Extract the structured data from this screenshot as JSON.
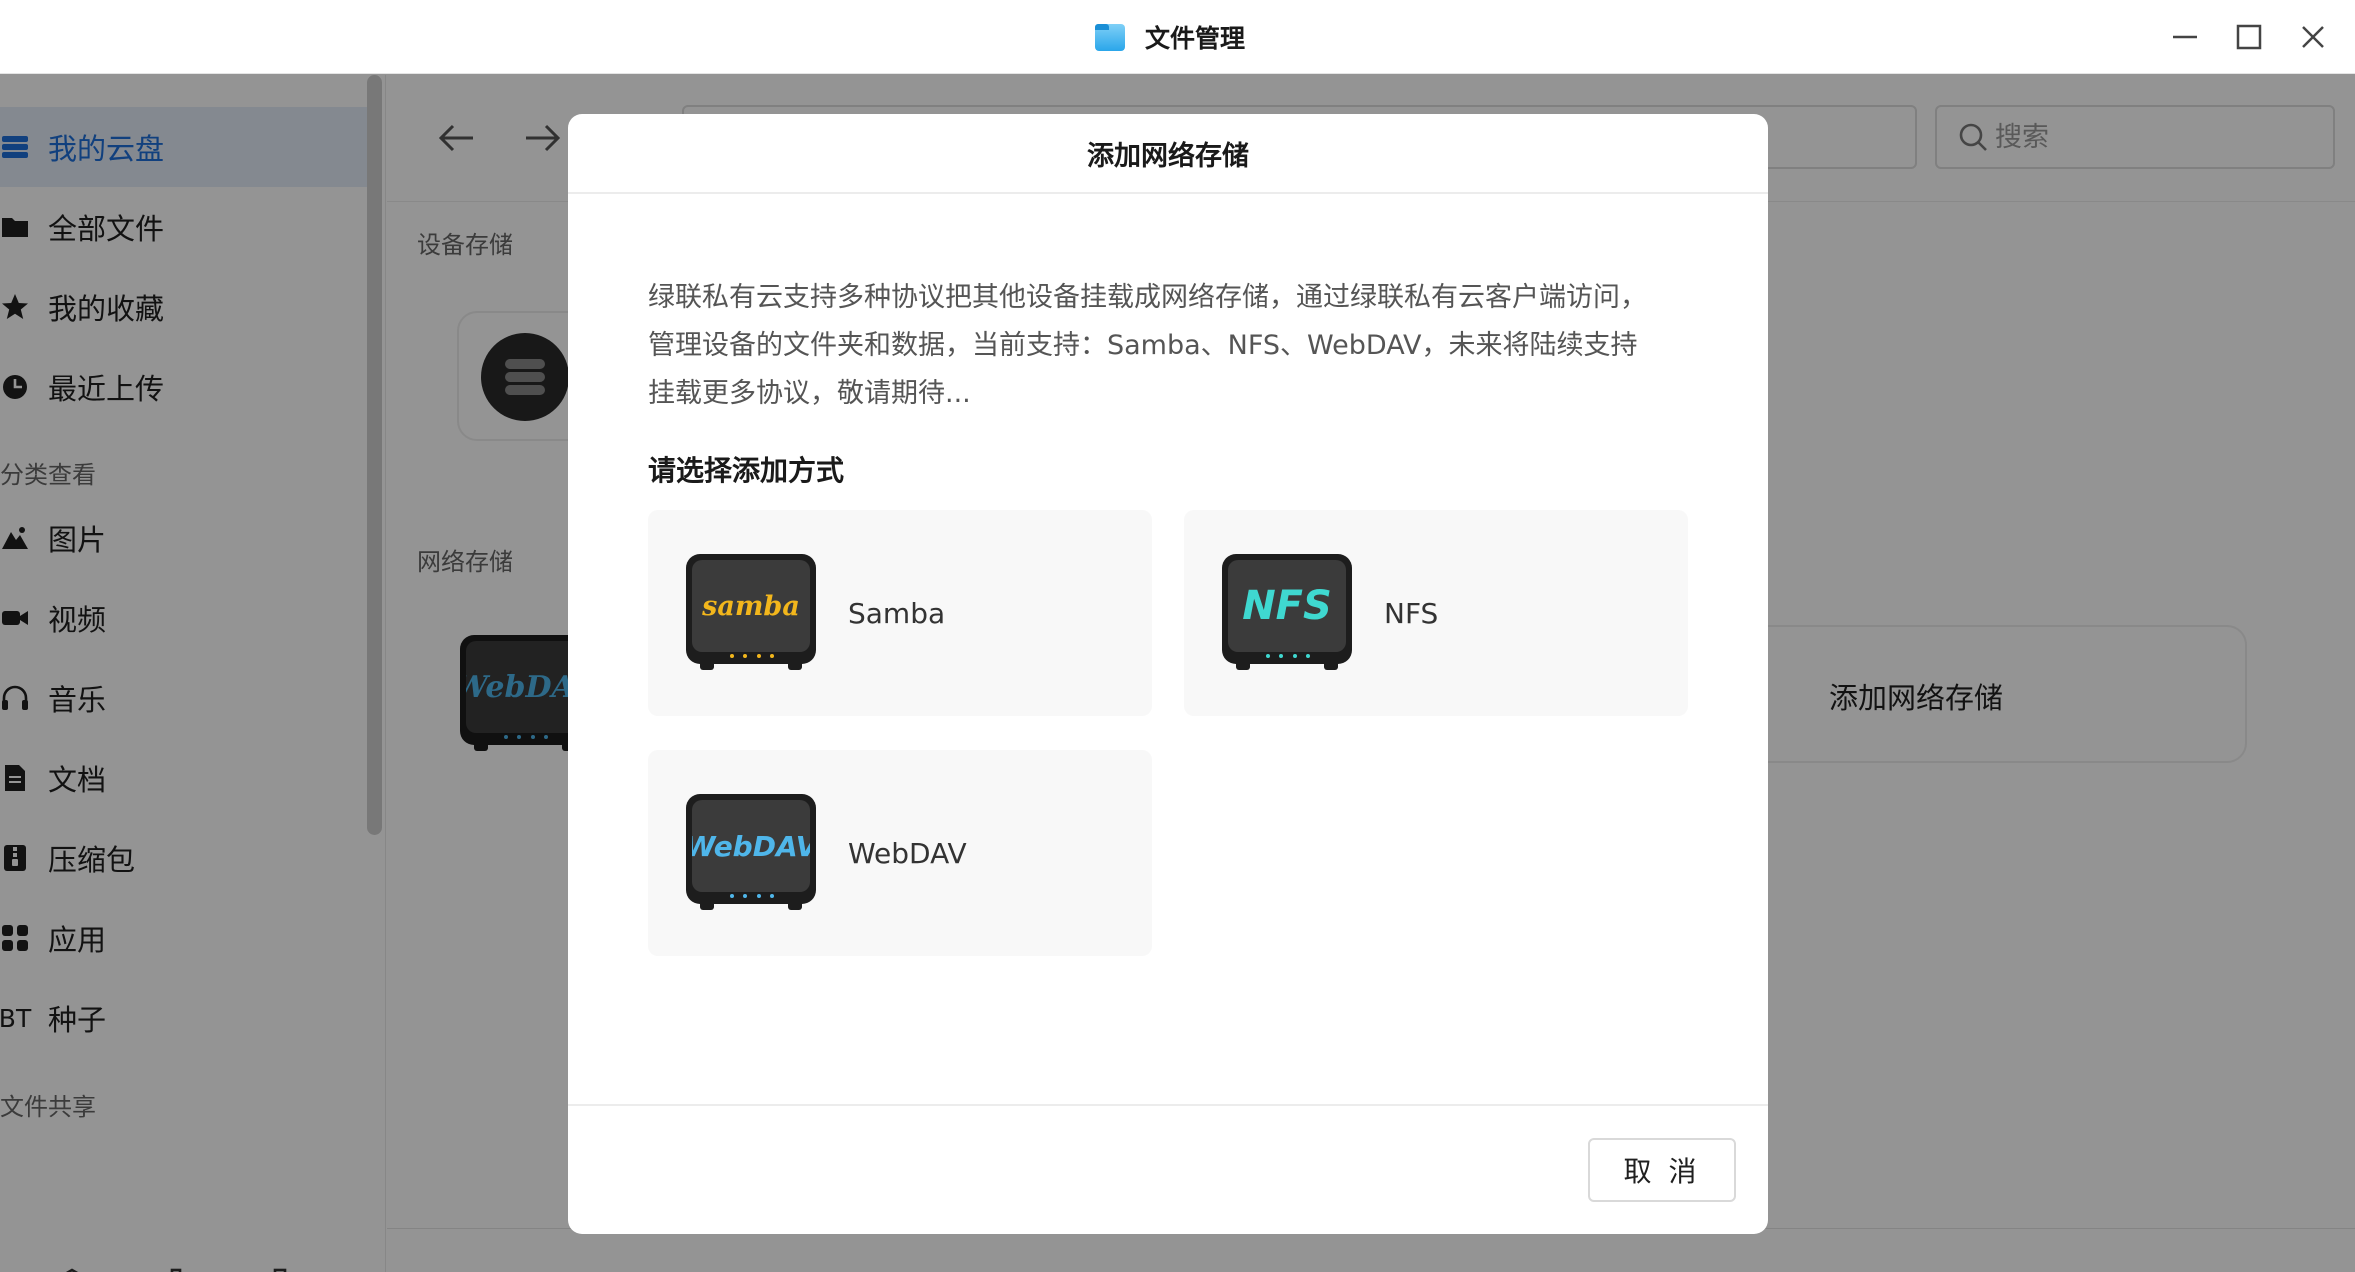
{
  "window": {
    "title": "文件管理"
  },
  "sidebar": {
    "items": [
      {
        "label": "我的云盘",
        "icon": "storage-icon",
        "active": true
      },
      {
        "label": "全部文件",
        "icon": "folder-icon"
      },
      {
        "label": "我的收藏",
        "icon": "star-icon"
      },
      {
        "label": "最近上传",
        "icon": "clock-icon"
      }
    ],
    "category_heading": "分类查看",
    "categories": [
      {
        "label": "图片",
        "icon": "image-icon"
      },
      {
        "label": "视频",
        "icon": "video-icon"
      },
      {
        "label": "音乐",
        "icon": "headphones-icon"
      },
      {
        "label": "文档",
        "icon": "document-icon"
      },
      {
        "label": "压缩包",
        "icon": "archive-icon"
      },
      {
        "label": "应用",
        "icon": "apps-icon"
      },
      {
        "label": "种子",
        "icon_text": "BT"
      }
    ],
    "share_heading": "文件共享"
  },
  "main": {
    "search_placeholder": "搜索",
    "device_storage_label": "设备存储",
    "network_storage_label": "网络存储",
    "webdav_tile_text": "WebDAV",
    "add_network_storage_label": "添加网络存储"
  },
  "modal": {
    "title": "添加网络存储",
    "description_lines": [
      "绿联私有云支持多种协议把其他设备挂载成网络存储，通过绿联私有云客户端访问，",
      "管理设备的文件夹和数据，当前支持：Samba、NFS、WebDAV，未来将陆续支持",
      "挂载更多协议，敬请期待..."
    ],
    "subtitle": "请选择添加方式",
    "options": [
      {
        "label": "Samba",
        "logo_text": "samba",
        "logo_color": "#f2b61c"
      },
      {
        "label": "NFS",
        "logo_text": "NFS",
        "logo_color": "#3fd8d0"
      },
      {
        "label": "WebDAV",
        "logo_text": "WebDAV",
        "logo_color": "#4fb6ea"
      }
    ],
    "cancel_label": "取 消"
  },
  "colors": {
    "accent": "#1e6fd9",
    "overlay": "rgba(0,0,0,0.42)"
  }
}
